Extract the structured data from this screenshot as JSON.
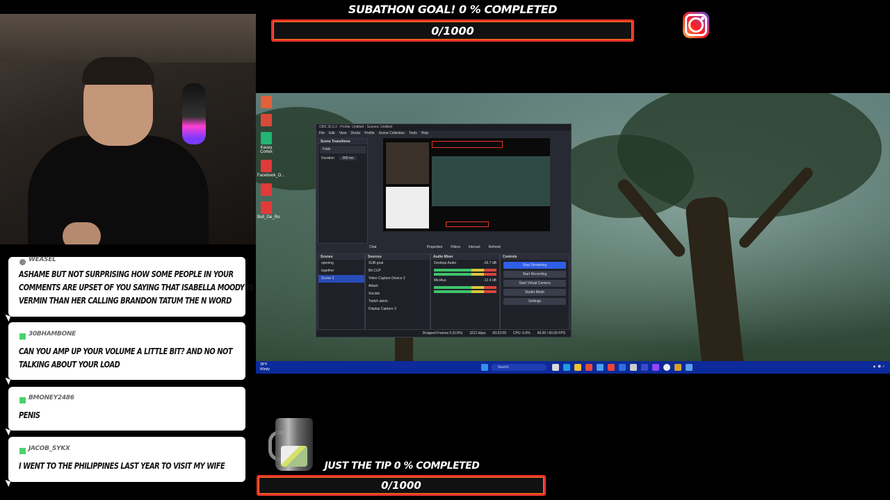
{
  "goal_top": {
    "title": "SUBATHON GOAL! 0 % COMPLETED",
    "progress_text": "0/1000",
    "progress_fraction": 0.0
  },
  "goal_bottom": {
    "title": "JUST THE TIP 0 % COMPLETED",
    "progress_text": "0/1000",
    "progress_fraction": 0.0
  },
  "instagram_icon": "instagram-icon",
  "chat": [
    {
      "user": "WEASEL",
      "badge_color": "#888888",
      "message": "ASHAME BUT NOT SURPRISING HOW SOME PEOPLE IN YOUR COMMENTS ARE UPSET OF YOU SAYING THAT ISABELLA MOODY IS VERMIN THAN HER CALLING BRANDON TATUM THE N WORD"
    },
    {
      "user": "30BHAMBONE",
      "badge_color": "#4bd26a",
      "message": "CAN YOU AMP UP YOUR VOLUME A LITTLE BIT? AND NO NOT TALKING ABOUT YOUR LOAD"
    },
    {
      "user": "BMONEY2486",
      "badge_color": "#4bd26a",
      "message": "PENIS"
    },
    {
      "user": "JACOB_SYKX",
      "badge_color": "#4bd26a",
      "message": "I WENT TO THE PHILIPPINES LAST YEAR TO VISIT MY WIFE"
    }
  ],
  "desktop": {
    "icons": [
      {
        "label": "",
        "color": "#e2613a"
      },
      {
        "label": "",
        "color": "#d84a3a"
      },
      {
        "label": "Kasey Cortex",
        "color": "#22b573"
      },
      {
        "label": "Facebook_O...",
        "color": "#e23a3a"
      },
      {
        "label": "",
        "color": "#e23a3a"
      },
      {
        "label": "Bull_Ge_Ro",
        "color": "#e23a3a"
      }
    ],
    "taskbar": {
      "weather": "38°F",
      "weather_sub": "Windy",
      "search_placeholder": "Search"
    }
  },
  "obs": {
    "title": "OBS 30.0.2 - Profile: Untitled - Scenes: Untitled",
    "menu": [
      "File",
      "Edit",
      "View",
      "Docks",
      "Profile",
      "Scene Collection",
      "Tools",
      "Help"
    ],
    "scene_transitions": {
      "header": "Scene Transitions",
      "transition": "Fade",
      "duration_label": "Duration",
      "duration_value": "300 ms"
    },
    "preview_toolbar": [
      "Chat",
      "Properties",
      "Filters",
      "Interact",
      "Refresh"
    ],
    "scenes": {
      "header": "Scenes",
      "items": [
        "opening",
        "together",
        "Scene 2"
      ],
      "selected": 2
    },
    "sources": {
      "header": "Sources",
      "items": [
        "SUB goal",
        "Bit CUP",
        "Video Capture Device 2",
        "Attack",
        "Socials",
        "Twitch alerts",
        "Display Capture 3"
      ]
    },
    "audio_mixer": {
      "header": "Audio Mixer",
      "channels": [
        {
          "name": "Desktop Audio",
          "db": "-26.7 dB"
        },
        {
          "name": "Mic/Aux",
          "db": "-12.4 dB"
        }
      ]
    },
    "controls": {
      "header": "Controls",
      "buttons": [
        "Stop Streaming",
        "Start Recording",
        "Start Virtual Camera",
        "Studio Mode",
        "Settings"
      ]
    },
    "status": {
      "dropped": "Dropped Frames 0 (0.0%)",
      "bitrate": "3221 kbps",
      "time": "00:22:09",
      "cpu": "CPU: 6.6%",
      "fps": "60.00 / 60.00 FPS"
    }
  }
}
